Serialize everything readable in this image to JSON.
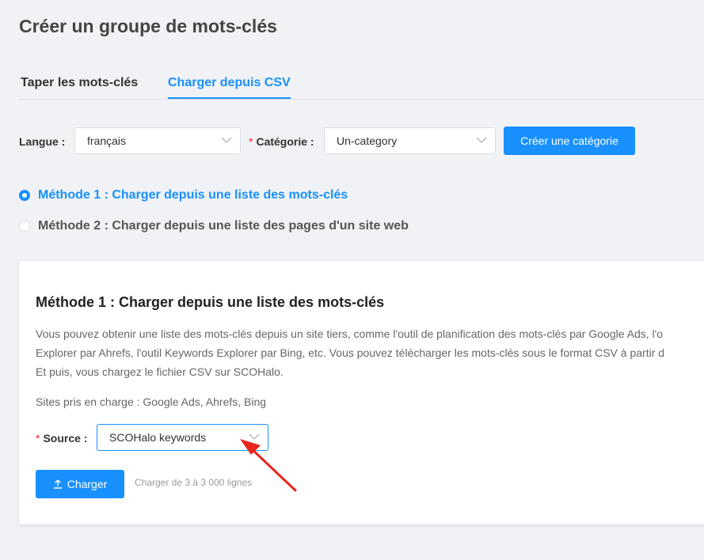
{
  "page": {
    "title": "Créer un groupe de mots-clés"
  },
  "tabs": [
    {
      "label": "Taper les mots-clés"
    },
    {
      "label": "Charger depuis CSV"
    }
  ],
  "filters": {
    "language_label": "Langue :",
    "language_value": "français",
    "category_label": "Catégorie :",
    "category_value": "Un-category",
    "create_category_button": "Créer une catégorie"
  },
  "methods": [
    {
      "label": "Méthode 1 : Charger depuis une liste des mots-clés"
    },
    {
      "label": "Méthode 2 : Charger depuis une liste des pages d'un site web"
    }
  ],
  "card": {
    "title": "Méthode 1 : Charger depuis une liste des mots-clés",
    "description": [
      "Vous pouvez obtenir une liste des mots-clés depuis un site tiers, comme l'outil de planification des mots-clés par Google Ads, l'o",
      "Explorer par Ahrefs, l'outil Keywords Explorer par Bing, etc. Vous pouvez télécharger les mots-clés sous le format CSV à partir d",
      "Et puis, vous chargez le fichier CSV sur SCOHalo."
    ],
    "sites": "Sites pris en charge : Google Ads, Ahrefs, Bing",
    "source_label": "Source :",
    "source_value": "SCOHalo keywords",
    "upload_button": "Charger",
    "upload_hint": "Charger de 3 à 3 000 lignes"
  },
  "colors": {
    "primary": "#1890ff",
    "required": "#f5222d",
    "annotation": "#e8261d"
  }
}
